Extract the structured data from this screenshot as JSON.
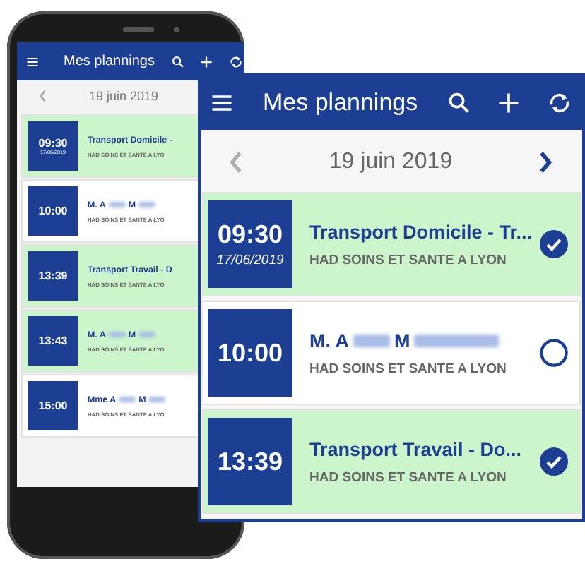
{
  "phone": {
    "header": {
      "title": "Mes plannings"
    },
    "date": "19 juin 2019",
    "appointments": [
      {
        "time": "09:30",
        "date": "17/06/2019",
        "title": "Transport Domicile -",
        "org": "HAD SOINS ET SANTE A LYO",
        "done": true
      },
      {
        "time": "10:00",
        "name_parts": [
          "M.  A",
          "M"
        ],
        "org": "HAD SOINS ET SANTE A LYO",
        "done": false
      },
      {
        "time": "13:39",
        "title": "Transport Travail - D",
        "org": "HAD SOINS ET SANTE A LYO",
        "done": true
      },
      {
        "time": "13:43",
        "name_parts": [
          "M.  A",
          "M"
        ],
        "org": "HAD SOINS ET SANTE A LYO",
        "done": true
      },
      {
        "time": "15:00",
        "name_parts": [
          "Mme A",
          "M"
        ],
        "org": "HAD SOINS ET SANTE A LYO",
        "done": false
      }
    ]
  },
  "zoom_panel": {
    "header": {
      "title": "Mes plannings"
    },
    "date": "19 juin 2019",
    "appointments": [
      {
        "time": "09:30",
        "date": "17/06/2019",
        "title": "Transport Domicile - Tr...",
        "org": "HAD SOINS ET SANTE A LYON",
        "done": true
      },
      {
        "time": "10:00",
        "name_parts": [
          "M.  A",
          "M"
        ],
        "org": "HAD SOINS ET SANTE A LYON",
        "done": false
      },
      {
        "time": "13:39",
        "title": "Transport Travail - Do...",
        "org": "HAD SOINS ET SANTE A LYON",
        "done": true
      }
    ]
  }
}
